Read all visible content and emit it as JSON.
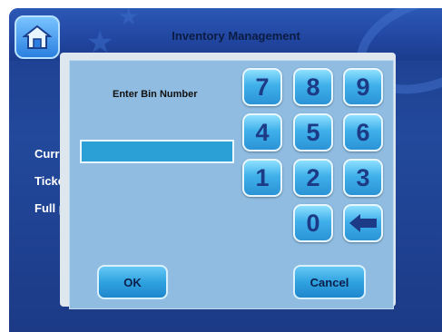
{
  "header": {
    "title": "Inventory Management",
    "home_icon": "home-icon"
  },
  "background_labels": [
    "Curre",
    "Ticket",
    "Full pa"
  ],
  "dialog": {
    "prompt": "Enter Bin Number",
    "input_value": "",
    "keypad": [
      "7",
      "8",
      "9",
      "4",
      "5",
      "6",
      "1",
      "2",
      "3",
      "0"
    ],
    "backspace_icon": "backspace-arrow-icon",
    "ok_label": "OK",
    "cancel_label": "Cancel"
  },
  "colors": {
    "screen_bg": "#22499c",
    "dialog_bg": "#8fbce0",
    "key_text": "#1d3a86",
    "input_bg": "#2aa0d6"
  }
}
